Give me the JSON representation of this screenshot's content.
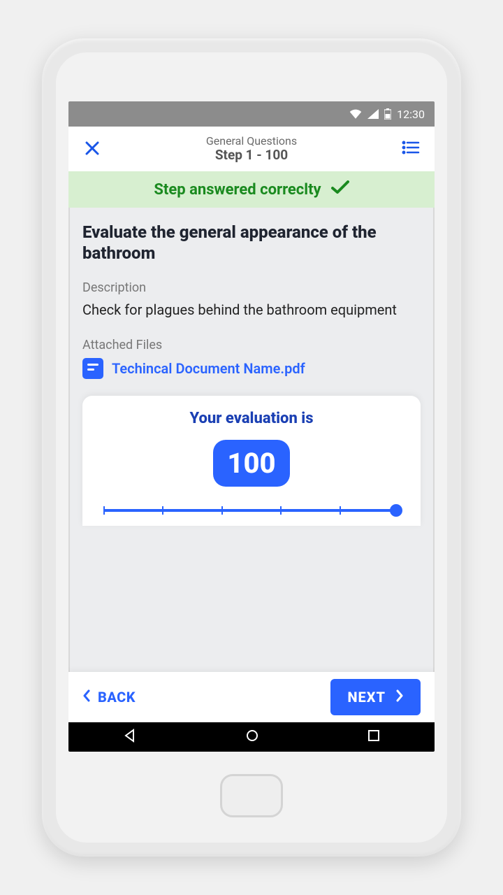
{
  "statusbar": {
    "time": "12:30"
  },
  "header": {
    "subtitle": "General Questions",
    "title": "Step 1 - 100"
  },
  "banner": {
    "text": "Step answered correclty"
  },
  "question": {
    "title": "Evaluate the general appearance of the bathroom",
    "description_label": "Description",
    "description_text": "Check for plagues behind the bathroom equipment",
    "attached_label": "Attached Files",
    "attached_file": "Techincal Document Name.pdf"
  },
  "evaluation": {
    "title": "Your evaluation is",
    "score": "100"
  },
  "footer": {
    "back": "BACK",
    "next": "NEXT"
  }
}
